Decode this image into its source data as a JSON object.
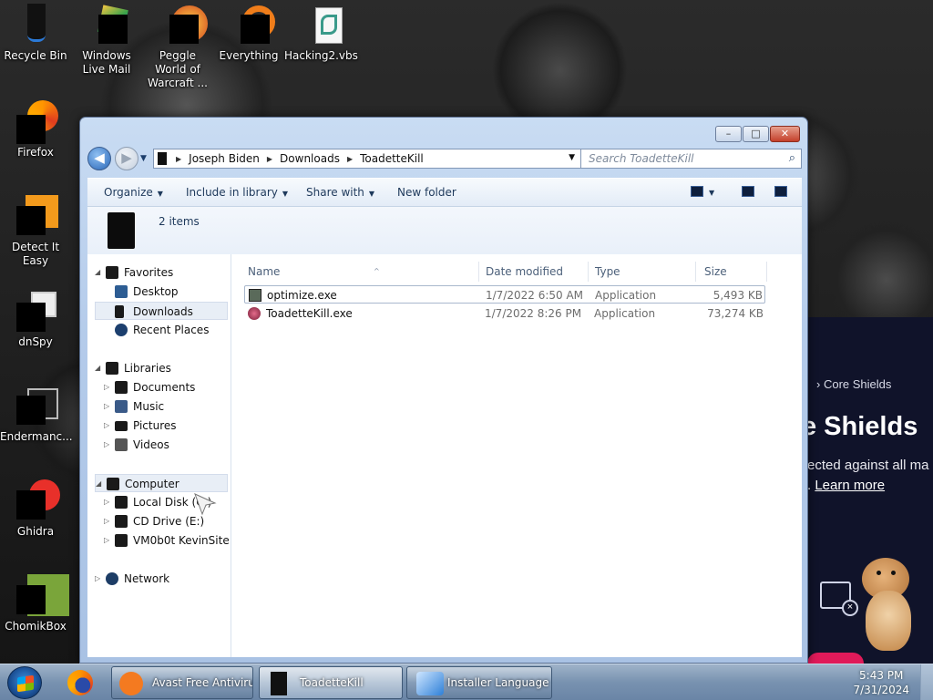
{
  "desktop": {
    "icons_top": [
      {
        "label": "Recycle Bin"
      },
      {
        "label": "Windows Live Mail"
      },
      {
        "label": "Peggle World of Warcraft ..."
      },
      {
        "label": "Everything"
      },
      {
        "label": "Hacking2.vbs"
      }
    ],
    "icons_left": [
      {
        "label": "Firefox"
      },
      {
        "label": "Detect It Easy"
      },
      {
        "label": "dnSpy"
      },
      {
        "label": "Endermanc..."
      },
      {
        "label": "Ghidra"
      },
      {
        "label": "ChomikBox"
      }
    ]
  },
  "avast_panel": {
    "breadcrumb": "Core Shields",
    "heading": "e Shields",
    "line1": "ected against all ma",
    "line2_prefix": ". ",
    "learn_more": "Learn more",
    "accent_color": "#e01a59"
  },
  "explorer": {
    "caption": {
      "minimize": "–",
      "maximize": "□",
      "close": "✕"
    },
    "nav": {
      "back": "◀",
      "forward": "▶",
      "dropdown": "▼"
    },
    "address": {
      "segments": [
        "Joseph Biden",
        "Downloads",
        "ToadetteKill"
      ],
      "separator": "▶",
      "dropdown": "▼",
      "refresh": "↻"
    },
    "search": {
      "placeholder": "Search ToadetteKill",
      "icon": "⌕"
    },
    "commands": {
      "organize": "Organize",
      "include_in_library": "Include in library",
      "share_with": "Share with",
      "new_folder": "New folder",
      "dropdown_glyph": "▼"
    },
    "details": {
      "item_count": "2 items"
    },
    "navpane": {
      "favorites": "Favorites",
      "desktop": "Desktop",
      "downloads": "Downloads",
      "recent_places": "Recent Places",
      "libraries": "Libraries",
      "documents": "Documents",
      "music": "Music",
      "pictures": "Pictures",
      "videos": "Videos",
      "computer": "Computer",
      "local_disk": "Local Disk (C:)",
      "cd_drive": "CD Drive (E:)",
      "vm_share": "VM0b0t KevinSite",
      "network": "Network",
      "expanded_glyph": "◢",
      "collapsed_glyph": "▷"
    },
    "columns": {
      "name": "Name",
      "date_modified": "Date modified",
      "type": "Type",
      "size": "Size",
      "sort_glyph": "^"
    },
    "files": [
      {
        "name": "optimize.exe",
        "date": "1/7/2022 6:50 AM",
        "type": "Application",
        "size": "5,493 KB"
      },
      {
        "name": "ToadetteKill.exe",
        "date": "1/7/2022 8:26 PM",
        "type": "Application",
        "size": "73,274 KB"
      }
    ]
  },
  "taskbar": {
    "items": [
      {
        "label": "Avast Free Antivirus"
      },
      {
        "label": "ToadetteKill"
      },
      {
        "label": "Installer Language"
      }
    ],
    "clock": {
      "time": "5:43 PM",
      "date": "7/31/2024"
    }
  }
}
